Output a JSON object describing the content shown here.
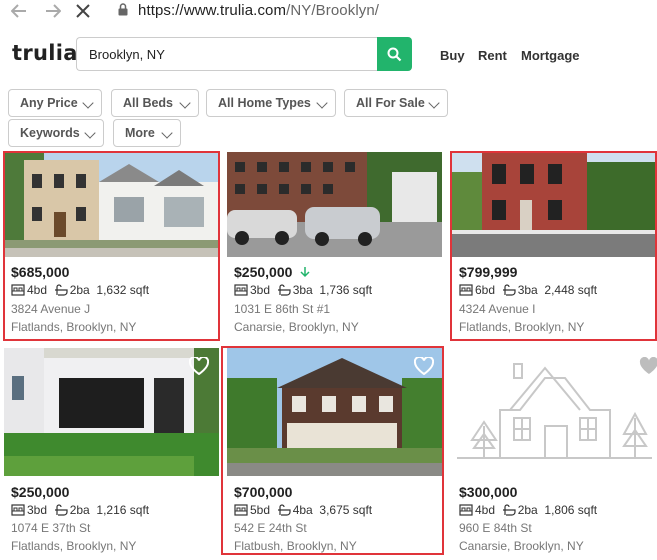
{
  "browser": {
    "url_prefix": "https://www.trulia.com",
    "url_path": "/NY/Brooklyn/"
  },
  "header": {
    "logo": "trulia",
    "search_value": "Brooklyn, NY",
    "nav": [
      "Buy",
      "Rent",
      "Mortgage"
    ]
  },
  "filters": [
    "Any Price",
    "All Beds",
    "All Home Types",
    "All For Sale",
    "Keywords",
    "More"
  ],
  "listings": [
    {
      "price": "$685,000",
      "beds": "4bd",
      "baths": "2ba",
      "sqft": "1,632 sqft",
      "address": "3824 Avenue J",
      "city": "Flatlands, Brooklyn, NY"
    },
    {
      "price": "$250,000",
      "beds": "3bd",
      "baths": "3ba",
      "sqft": "1,736 sqft",
      "address": "1031 E 86th St #1",
      "city": "Canarsie, Brooklyn, NY",
      "price_drop": true
    },
    {
      "price": "$799,999",
      "beds": "6bd",
      "baths": "3ba",
      "sqft": "2,448 sqft",
      "address": "4324 Avenue I",
      "city": "Flatlands, Brooklyn, NY"
    },
    {
      "price": "$250,000",
      "beds": "3bd",
      "baths": "2ba",
      "sqft": "1,216 sqft",
      "address": "1074 E 37th St",
      "city": "Flatlands, Brooklyn, NY"
    },
    {
      "price": "$700,000",
      "beds": "5bd",
      "baths": "4ba",
      "sqft": "3,675 sqft",
      "address": "542 E 24th St",
      "city": "Flatbush, Brooklyn, NY"
    },
    {
      "price": "$300,000",
      "beds": "4bd",
      "baths": "2ba",
      "sqft": "1,806 sqft",
      "address": "960 E 84th St",
      "city": "Canarsie, Brooklyn, NY"
    }
  ],
  "colors": {
    "accent": "#22b46c",
    "highlight": "#e0343a"
  }
}
